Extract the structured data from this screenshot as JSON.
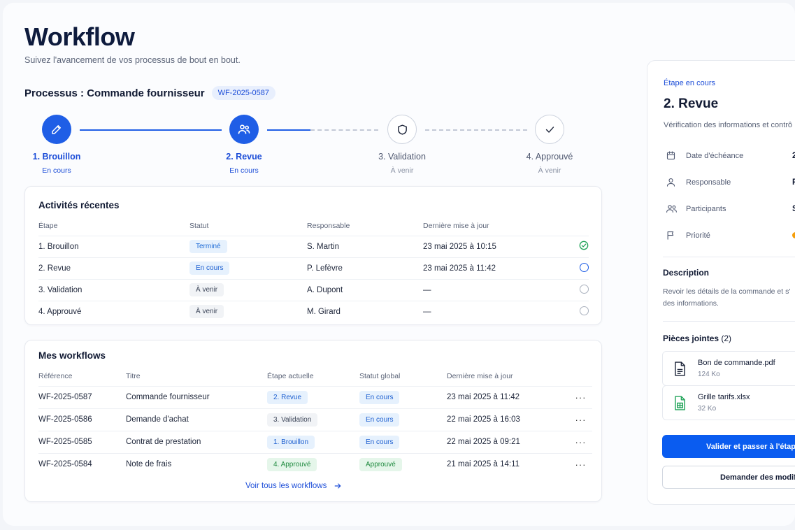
{
  "header": {
    "title": "Workflow",
    "subtitle": "Suivez l'avancement de vos processus de bout en bout."
  },
  "process": {
    "label": "Processus : Commande fournisseur",
    "reference": "WF-2025-0587"
  },
  "steps": [
    {
      "name": "1. Brouillon",
      "status": "En cours",
      "state": "active",
      "icon": "pencil-icon"
    },
    {
      "name": "2. Revue",
      "status": "En cours",
      "state": "active",
      "icon": "users-icon"
    },
    {
      "name": "3. Validation",
      "status": "À venir",
      "state": "pending",
      "icon": "shield-icon"
    },
    {
      "name": "4. Approuvé",
      "status": "À venir",
      "state": "pending",
      "icon": "check-icon"
    }
  ],
  "activities": {
    "title": "Activités récentes",
    "columns": [
      "Étape",
      "Statut",
      "Responsable",
      "Dernière mise à jour"
    ],
    "rows": [
      {
        "step": "1. Brouillon",
        "status": "Terminé",
        "status_kind": "done",
        "owner": "S. Martin",
        "updated": "23 mai 2025 à 10:15",
        "icon": "check-circle-icon"
      },
      {
        "step": "2. Revue",
        "status": "En cours",
        "status_kind": "prog",
        "owner": "P. Lefèvre",
        "updated": "23 mai 2025 à 11:42",
        "icon": "circle-active-icon"
      },
      {
        "step": "3. Validation",
        "status": "À venir",
        "status_kind": "wait",
        "owner": "A. Dupont",
        "updated": "—",
        "icon": "circle-empty-icon"
      },
      {
        "step": "4. Approuvé",
        "status": "À venir",
        "status_kind": "wait",
        "owner": "M. Girard",
        "updated": "—",
        "icon": "circle-empty-icon"
      }
    ]
  },
  "workflows": {
    "title": "Mes workflows",
    "columns": [
      "Référence",
      "Titre",
      "Étape actuelle",
      "Statut global",
      "Dernière mise à jour"
    ],
    "rows": [
      {
        "ref": "WF-2025-0587",
        "title": "Commande fournisseur",
        "stage": "2. Revue",
        "stage_kind": "prog",
        "status": "En cours",
        "status_kind": "prog",
        "updated": "23 mai 2025 à 11:42"
      },
      {
        "ref": "WF-2025-0586",
        "title": "Demande d'achat",
        "stage": "3. Validation",
        "stage_kind": "wait",
        "status": "En cours",
        "status_kind": "prog",
        "updated": "22 mai 2025 à 16:03"
      },
      {
        "ref": "WF-2025-0585",
        "title": "Contrat de prestation",
        "stage": "1. Brouillon",
        "stage_kind": "prog",
        "status": "En cours",
        "status_kind": "prog",
        "updated": "22 mai 2025 à 09:21"
      },
      {
        "ref": "WF-2025-0584",
        "title": "Note de frais",
        "stage": "4. Approuvé",
        "stage_kind": "approved",
        "status": "Approuvé",
        "status_kind": "approved",
        "updated": "21 mai 2025 à 14:11"
      }
    ],
    "more_label": "···",
    "see_all": "Voir tous les workflows"
  },
  "panel": {
    "kicker": "Étape en cours",
    "title": "2. Revue",
    "description": "Vérification des informations et contrô",
    "meta": [
      {
        "label": "Date d'échéance",
        "value": "2",
        "icon": "calendar-icon"
      },
      {
        "label": "Responsable",
        "value": "P.",
        "icon": "user-icon"
      },
      {
        "label": "Participants",
        "value": "S",
        "icon": "users-icon"
      },
      {
        "label": "Priorité",
        "value": "",
        "icon": "flag-icon"
      }
    ],
    "priority_color": "#f59e0b",
    "description_title": "Description",
    "description_text": [
      "Revoir les détails de la commande et s'",
      "des informations."
    ],
    "attachments_title": "Pièces jointes",
    "attachments_count": "(2)",
    "files": [
      {
        "name": "Bon de commande.pdf",
        "size": "124 Ko",
        "icon": "pdf-file-icon"
      },
      {
        "name": "Grille tarifs.xlsx",
        "size": "32 Ko",
        "icon": "spreadsheet-file-icon"
      }
    ],
    "primary_button": "Valider et passer à l'étape",
    "secondary_button": "Demander des modific"
  },
  "colors": {
    "accent": "#1f5ee6",
    "primary_button": "#0a5cf0",
    "success": "#22a45a"
  }
}
